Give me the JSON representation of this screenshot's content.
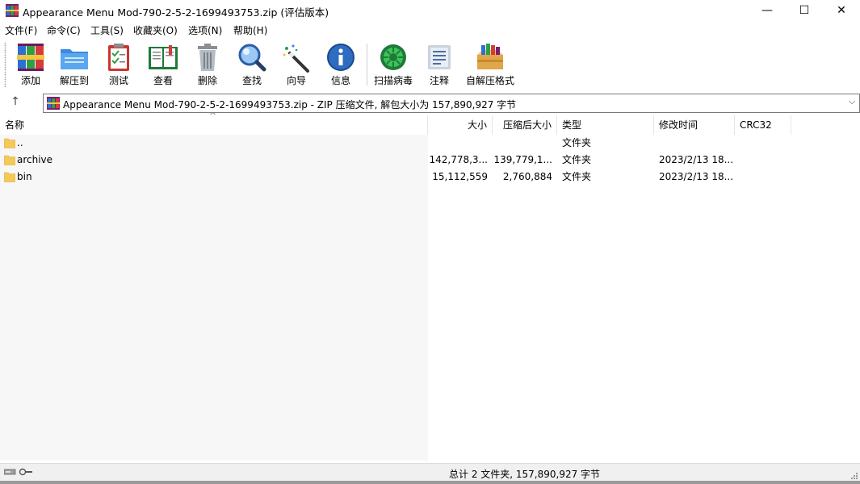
{
  "window": {
    "title": "Appearance Menu Mod-790-2-5-2-1699493753.zip (评估版本)",
    "minimize_glyph": "—",
    "maximize_glyph": "☐",
    "close_glyph": "✕"
  },
  "menu": [
    {
      "label": "文件(F)"
    },
    {
      "label": "命令(C)"
    },
    {
      "label": "工具(S)"
    },
    {
      "label": "收藏夹(O)"
    },
    {
      "label": "选项(N)"
    },
    {
      "label": "帮助(H)"
    }
  ],
  "toolbar": [
    {
      "label": "添加",
      "icon": "add-archive-icon"
    },
    {
      "label": "解压到",
      "icon": "extract-folder-icon"
    },
    {
      "label": "测试",
      "icon": "test-clipboard-icon"
    },
    {
      "label": "查看",
      "icon": "view-book-icon"
    },
    {
      "label": "删除",
      "icon": "trash-icon"
    },
    {
      "label": "查找",
      "icon": "magnifier-icon"
    },
    {
      "label": "向导",
      "icon": "wizard-wand-icon"
    },
    {
      "label": "信息",
      "icon": "info-icon"
    },
    {
      "label": "扫描病毒",
      "icon": "virus-scan-icon"
    },
    {
      "label": "注释",
      "icon": "comment-icon"
    },
    {
      "label": "自解压格式",
      "icon": "sfx-box-icon"
    }
  ],
  "address": {
    "up_glyph": "↑",
    "path": "Appearance Menu Mod-790-2-5-2-1699493753.zip - ZIP 压缩文件, 解包大小为 157,890,927 字节",
    "dropdown_glyph": "⌵"
  },
  "columns": {
    "name": "名称",
    "size": "大小",
    "packed": "压缩后大小",
    "type": "类型",
    "modified": "修改时间",
    "crc": "CRC32"
  },
  "files": [
    {
      "name": "..",
      "size": "",
      "packed": "",
      "type": "文件夹",
      "modified": ""
    },
    {
      "name": "archive",
      "size": "142,778,3...",
      "packed": "139,779,1...",
      "type": "文件夹",
      "modified": "2023/2/13 18..."
    },
    {
      "name": "bin",
      "size": "15,112,559",
      "packed": "2,760,884",
      "type": "文件夹",
      "modified": "2023/2/13 18..."
    }
  ],
  "status": {
    "summary": "总计 2 文件夹, 157,890,927 字节"
  },
  "colors": {
    "folder": "#f5c85a",
    "name_column_bg": "#f7f7f7"
  }
}
